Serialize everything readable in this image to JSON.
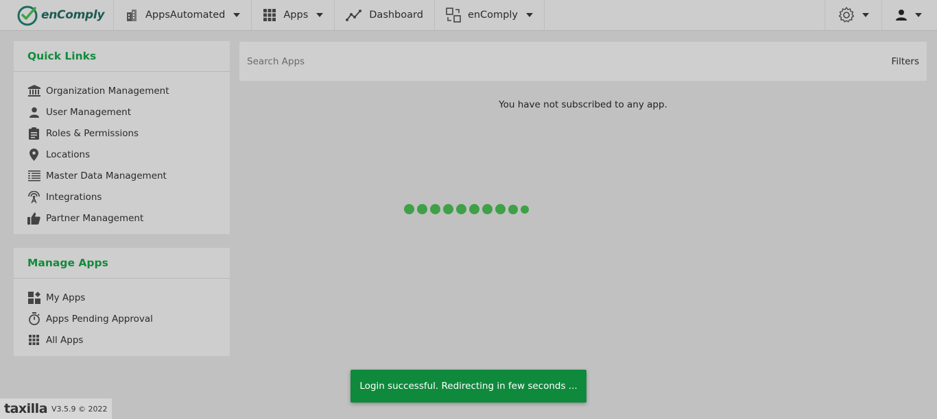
{
  "brand": {
    "name": "enComply"
  },
  "nav": {
    "org": "AppsAutomated",
    "apps": "Apps",
    "dashboard": "Dashboard",
    "product": "enComply"
  },
  "quick_links": {
    "title": "Quick Links",
    "items": [
      {
        "label": "Organization Management",
        "icon": "bank-icon"
      },
      {
        "label": "User Management",
        "icon": "user-icon"
      },
      {
        "label": "Roles & Permissions",
        "icon": "clipboard-icon"
      },
      {
        "label": "Locations",
        "icon": "location-pin-icon"
      },
      {
        "label": "Master Data Management",
        "icon": "data-list-icon"
      },
      {
        "label": "Integrations",
        "icon": "antenna-icon"
      },
      {
        "label": "Partner Management",
        "icon": "thumbs-up-icon"
      }
    ]
  },
  "manage_apps": {
    "title": "Manage Apps",
    "items": [
      {
        "label": "My Apps",
        "icon": "widgets-icon"
      },
      {
        "label": "Apps Pending Approval",
        "icon": "timer-icon"
      },
      {
        "label": "All Apps",
        "icon": "grid-icon"
      }
    ]
  },
  "search": {
    "placeholder": "Search Apps",
    "filters_label": "Filters"
  },
  "empty_message": "You have not subscribed to any app.",
  "toast": "Login successful. Redirecting in few seconds ...",
  "footer": {
    "logo": "taxilla",
    "version": "V3.5.9 © 2022"
  },
  "colors": {
    "accent": "#138a3c",
    "toast_bg": "#0f8a3c",
    "loader_dot": "#3fa047"
  },
  "loader_dots": 10
}
